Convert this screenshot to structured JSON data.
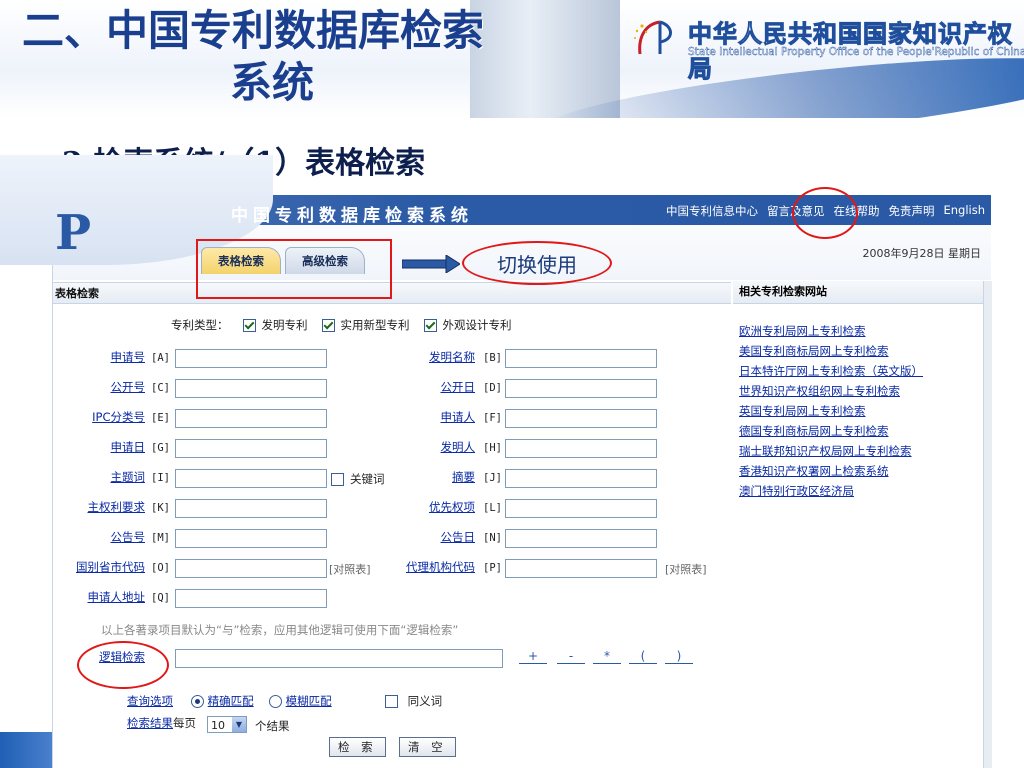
{
  "slide": {
    "title_line1": "二、中国专利数据库检索",
    "title_line2": "系统",
    "subtitle": "2.检索系统/（1）表格检索",
    "org_cn": "中华人民共和国国家知识产权局",
    "org_en": "State Intellectual Property Office of the People'Republic of China",
    "annotation": "切换使用"
  },
  "app": {
    "logo": "P",
    "title": "中国专利数据库检索系统",
    "topnav": [
      "中国专利信息中心",
      "留言及意见",
      "在线帮助",
      "免责声明",
      "English"
    ],
    "date": "2008年9月28日 星期日",
    "tabs": [
      "表格检索",
      "高级检索"
    ],
    "section_title": "表格检索",
    "patent_type_label": "专利类型：",
    "patent_types": [
      {
        "label": "发明专利",
        "checked": true
      },
      {
        "label": "实用新型专利",
        "checked": true
      },
      {
        "label": "外观设计专利",
        "checked": true
      }
    ],
    "fields_left": [
      {
        "label": "申请号",
        "code": "[A]"
      },
      {
        "label": "公开号",
        "code": "[C]"
      },
      {
        "label": "IPC分类号",
        "code": "[E]"
      },
      {
        "label": "申请日",
        "code": "[G]"
      },
      {
        "label": "主题词",
        "code": "[I]"
      },
      {
        "label": "主权利要求",
        "code": "[K]"
      },
      {
        "label": "公告号",
        "code": "[M]"
      },
      {
        "label": "国别省市代码",
        "code": "[O]"
      },
      {
        "label": "申请人地址",
        "code": "[Q]"
      }
    ],
    "fields_right": [
      {
        "label": "发明名称",
        "code": "[B]"
      },
      {
        "label": "公开日",
        "code": "[D]"
      },
      {
        "label": "申请人",
        "code": "[F]"
      },
      {
        "label": "发明人",
        "code": "[H]"
      },
      {
        "label": "摘要",
        "code": "[J]"
      },
      {
        "label": "优先权项",
        "code": "[L]"
      },
      {
        "label": "公告日",
        "code": "[N]"
      },
      {
        "label": "代理机构代码",
        "code": "[P]"
      }
    ],
    "keyword_label": "关键词",
    "ref_table": "[对照表]",
    "hint": "以上各著录项目默认为“与”检索，应用其他逻辑可使用下面“逻辑检索”",
    "logic_label": "逻辑检索",
    "logic_ops": [
      "+",
      "-",
      "*",
      "(",
      ")"
    ],
    "query_label": "查询选项",
    "match_exact": "精确匹配",
    "match_fuzzy": "模糊匹配",
    "synonym": "同义词",
    "results_label": "检索结果",
    "per_page": "每页",
    "per_page_value": "10",
    "results_unit": "个结果",
    "search_btn": "检 索",
    "clear_btn": "清 空",
    "side_title": "相关专利检索网站",
    "side_links": [
      "欧洲专利局网上专利检索",
      "美国专利商标局网上专利检索",
      "日本特许厅网上专利检索（英文版）",
      "世界知识产权组织网上专利检索",
      "英国专利局网上专利检索",
      "德国专利商标局网上专利检索",
      "瑞士联邦知识产权局网上专利检索",
      "香港知识产权署网上检索系统",
      "澳门特别行政区经济局"
    ]
  },
  "colors": {
    "accent": "#2a5aa6",
    "annotation": "#e01818",
    "title": "#1b3f8f"
  }
}
